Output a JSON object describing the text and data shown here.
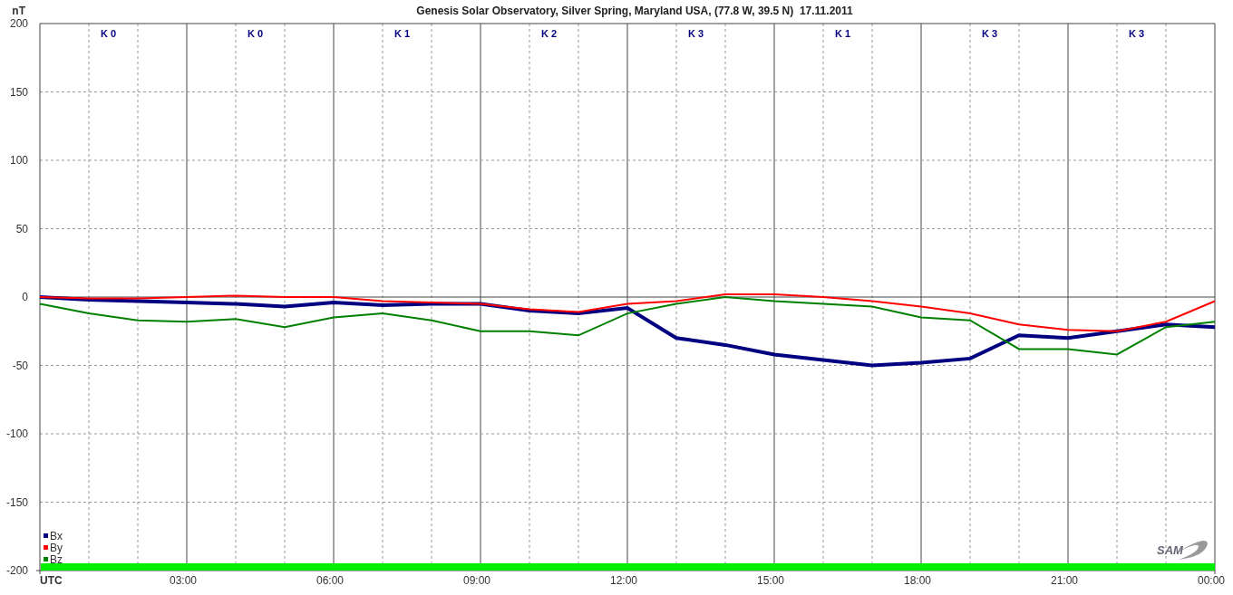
{
  "chart": {
    "title": "Genesis Solar Observatory, Silver Spring, Maryland USA, (77.8 W, 39.5 N)  17.11.2011",
    "logo": "SAM",
    "chart_data": {
      "type": "line",
      "ylabel": "nT",
      "x": [
        0,
        1,
        2,
        3,
        4,
        5,
        6,
        7,
        8,
        9,
        10,
        11,
        12,
        13,
        14,
        15,
        16,
        17,
        18,
        19,
        20,
        21,
        22,
        23,
        24
      ],
      "xlim": [
        0,
        24
      ],
      "ylim": [
        -200,
        200
      ],
      "xticks": [
        {
          "value": 0,
          "label": "UTC"
        },
        {
          "value": 3,
          "label": "03:00"
        },
        {
          "value": 6,
          "label": "06:00"
        },
        {
          "value": 9,
          "label": "09:00"
        },
        {
          "value": 12,
          "label": "12:00"
        },
        {
          "value": 15,
          "label": "15:00"
        },
        {
          "value": 18,
          "label": "18:00"
        },
        {
          "value": 21,
          "label": "21:00"
        },
        {
          "value": 24,
          "label": "00:00"
        }
      ],
      "yticks": [
        -200,
        -150,
        -100,
        -50,
        0,
        50,
        100,
        150,
        200
      ],
      "series": [
        {
          "name": "Bx",
          "color": "#000080",
          "values": [
            0,
            -2,
            -3,
            -4,
            -5,
            -7,
            -4,
            -6,
            -5,
            -5,
            -10,
            -12,
            -8,
            -30,
            -35,
            -42,
            -46,
            -50,
            -48,
            -45,
            -28,
            -30,
            -25,
            -20,
            -22
          ]
        },
        {
          "name": "By",
          "color": "#ff0000",
          "values": [
            0,
            -1,
            -1,
            0,
            1,
            0,
            0,
            -3,
            -4,
            -5,
            -9,
            -11,
            -5,
            -3,
            2,
            2,
            0,
            -3,
            -7,
            -12,
            -20,
            -24,
            -25,
            -18,
            -3
          ]
        },
        {
          "name": "Bz",
          "color": "#008000",
          "values": [
            -5,
            -12,
            -17,
            -18,
            -16,
            -22,
            -15,
            -12,
            -17,
            -25,
            -25,
            -28,
            -12,
            -5,
            0,
            -3,
            -5,
            -7,
            -15,
            -17,
            -38,
            -38,
            -42,
            -22,
            -18
          ]
        }
      ],
      "grid": true,
      "legend": true
    },
    "k_indices": [
      "K 0",
      "K 0",
      "K 1",
      "K 2",
      "K 3",
      "K 1",
      "K 3",
      "K 3"
    ]
  }
}
